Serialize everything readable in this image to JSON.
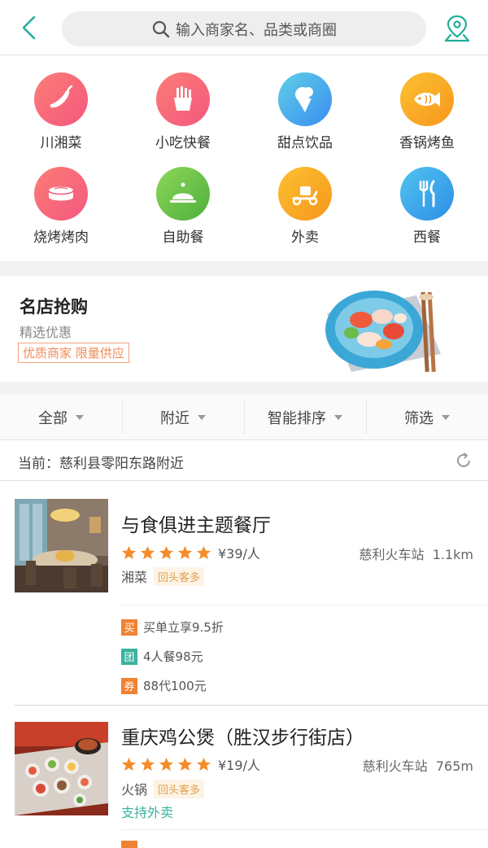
{
  "header": {
    "search_placeholder": "输入商家名、品类或商圈"
  },
  "categories": [
    {
      "label": "川湘菜",
      "icon": "chili-icon",
      "color": "#f76a7b"
    },
    {
      "label": "小吃快餐",
      "icon": "fries-icon",
      "color": "#f7616f"
    },
    {
      "label": "甜点饮品",
      "icon": "ice-cream-icon",
      "color": "#4fb2ee"
    },
    {
      "label": "香锅烤鱼",
      "icon": "fish-icon",
      "color": "#f9a825"
    },
    {
      "label": "烧烤烤肉",
      "icon": "meat-icon",
      "color": "#f7616f"
    },
    {
      "label": "自助餐",
      "icon": "cloche-icon",
      "color": "#6fc244"
    },
    {
      "label": "外卖",
      "icon": "scooter-icon",
      "color": "#f8b322"
    },
    {
      "label": "西餐",
      "icon": "fork-knife-icon",
      "color": "#3aa8e8"
    }
  ],
  "promo": {
    "title": "名店抢购",
    "subtitle": "精选优惠",
    "tag": "优质商家 限量供应"
  },
  "filters": [
    "全部",
    "附近",
    "智能排序",
    "筛选"
  ],
  "location": {
    "text": "当前：慈利县零阳东路附近"
  },
  "shops": [
    {
      "name": "与食俱进主题餐厅",
      "rating": 5,
      "price": "¥39/人",
      "area": "慈利火车站",
      "distance": "1.1km",
      "cuisine": "湘菜",
      "badge": "回头客多",
      "deals": [
        {
          "badge": "买",
          "color": "#f08233",
          "text": "买单立享9.5折"
        },
        {
          "badge": "团",
          "color": "#3bb39e",
          "text": "4人餐98元"
        },
        {
          "badge": "券",
          "color": "#f08233",
          "text": "88代100元"
        }
      ]
    },
    {
      "name": "重庆鸡公煲（胜汉步行街店）",
      "rating": 5,
      "price": "¥19/人",
      "area": "慈利火车站",
      "distance": "765m",
      "cuisine": "火锅",
      "badge": "回头客多",
      "takeout": "支持外卖"
    }
  ],
  "colors": {
    "accent": "#1fae9a",
    "star": "#f58c2a"
  }
}
